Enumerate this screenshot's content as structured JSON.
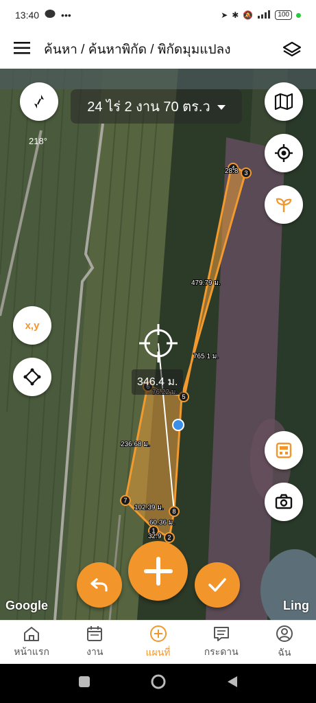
{
  "status_bar": {
    "time": "13:40",
    "battery": "100"
  },
  "header": {
    "title": "ค้นหา / ค้นหาพิกัด / พิกัดมุมแปลง"
  },
  "map": {
    "area_label": "24 ไร่ 2 งาน 70 ตร.ว",
    "rotation": "218°",
    "xy_button": "x,y",
    "measure_distance": "346.4 ม.",
    "segment_labels": [
      "479.79 ม.",
      "765.1 ม.",
      "76.22 ม.",
      "236.68 ม.",
      "102.39 ม.",
      "60.36 ม.",
      "32.9",
      "28.8"
    ],
    "point_numbers": [
      "1",
      "2",
      "3",
      "4",
      "5",
      "6",
      "7",
      "8"
    ],
    "attribution_left": "Google",
    "attribution_right": "Ling"
  },
  "bottom_nav": {
    "items": [
      {
        "label": "หน้าแรก",
        "icon": "home-icon"
      },
      {
        "label": "งาน",
        "icon": "calendar-icon"
      },
      {
        "label": "แผนที่",
        "icon": "add-circle-icon"
      },
      {
        "label": "กระดาน",
        "icon": "board-icon"
      },
      {
        "label": "ฉัน",
        "icon": "person-icon"
      }
    ]
  },
  "colors": {
    "accent": "#f2962c",
    "plot_fill": "#e89a3a",
    "plot_stroke": "#f29a2e"
  }
}
